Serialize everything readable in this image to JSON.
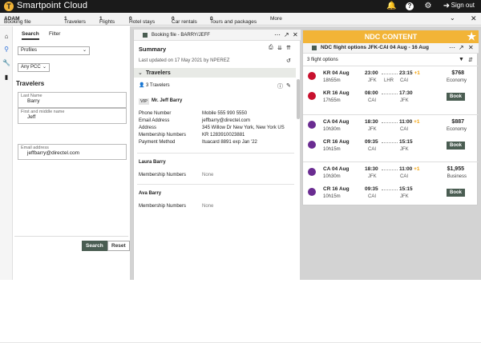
{
  "app": {
    "name": "Smartpoint Cloud",
    "logo": "T",
    "signout": "Sign out"
  },
  "icons": {
    "bell": "bell-icon",
    "help": "help-icon",
    "gear": "gear-icon",
    "signout": "signout-icon"
  },
  "tabs": {
    "booking_label": "Booking file",
    "booking_value": "ADAM",
    "travelers_label": "Travelers",
    "travelers_value": "1",
    "flights_label": "Flights",
    "flights_value": "1",
    "hotel_label": "Hotel stays",
    "hotel_value": "0",
    "car_label": "Car rentals",
    "car_value": "0",
    "tours_label": "Tours and packages",
    "tours_value": "0",
    "more": "More"
  },
  "sidebar": {
    "tab_search": "Search",
    "tab_filter": "Filter",
    "profiles": "Profiles",
    "pcc": "Any PCC",
    "section": "Travelers",
    "last_name_label": "Last Name",
    "last_name_value": "Barry",
    "first_name_label": "First and middle name",
    "first_name_value": "Jeff",
    "email_label": "Email address",
    "email_value": "jeffbarry@directel.com",
    "search_btn": "Search",
    "reset_btn": "Reset"
  },
  "booking": {
    "title": "Booking file - BARRY/JEFF",
    "summary": "Summary",
    "updated": "Last updated on 17 May 2021 by NPEREZ",
    "travelers_header": "Travelers",
    "travelers_count": "3 Travelers",
    "vip": "VIP",
    "primary_name": "Mr. Jeff Barry",
    "fields": [
      {
        "label": "Phone Number",
        "value": "Mobile 555 990 5550"
      },
      {
        "label": "Email Address",
        "value": "jeffbarry@directel.com"
      },
      {
        "label": "Address",
        "value": "345 Willow Dr New York, New York US"
      },
      {
        "label": "Membership Numbers",
        "value": "KR 1283910023881"
      },
      {
        "label": "Payment Method",
        "value": "Ituacard 8891 exp Jan '22"
      }
    ],
    "t2_name": "Laura Barry",
    "t2_label": "Membership Numbers",
    "t2_value": "None",
    "t3_name": "Ava Barry",
    "t3_label": "Membership Numbers",
    "t3_value": "None"
  },
  "ndc": {
    "header": "NDC CONTENT",
    "title": "NDC flight options JFK-CAI 04 Aug - 16 Aug",
    "count": "3 flight options",
    "book": "Book",
    "options": [
      {
        "price": "$768",
        "cabin": "Economy",
        "color": "#c8102e",
        "legs": [
          {
            "flight": "KR 04 Aug",
            "dur": "18h55m",
            "dep": "23:00",
            "arr": "23:15",
            "plus": "+1",
            "from": "JFK",
            "via": "LHR",
            "to": "CAI"
          },
          {
            "flight": "KR 16 Aug",
            "dur": "17h55m",
            "dep": "08:00",
            "arr": "17:30",
            "plus": "",
            "from": "CAI",
            "via": "",
            "to": "JFK"
          }
        ]
      },
      {
        "price": "$887",
        "cabin": "Economy",
        "color": "#6a2c91",
        "legs": [
          {
            "flight": "CA 04 Aug",
            "dur": "10h30m",
            "dep": "18:30",
            "arr": "11:00",
            "plus": "+1",
            "from": "JFK",
            "via": "",
            "to": "CAI"
          },
          {
            "flight": "CR 16 Aug",
            "dur": "10h15m",
            "dep": "09:35",
            "arr": "15:15",
            "plus": "",
            "from": "CAI",
            "via": "",
            "to": "JFK"
          }
        ]
      },
      {
        "price": "$1,955",
        "cabin": "Business",
        "color": "#6a2c91",
        "legs": [
          {
            "flight": "CA 04 Aug",
            "dur": "10h30m",
            "dep": "18:30",
            "arr": "11:00",
            "plus": "+1",
            "from": "JFK",
            "via": "",
            "to": "CAI"
          },
          {
            "flight": "CR 16 Aug",
            "dur": "10h15m",
            "dep": "09:35",
            "arr": "15:15",
            "plus": "",
            "from": "CAI",
            "via": "",
            "to": "JFK"
          }
        ]
      }
    ]
  }
}
